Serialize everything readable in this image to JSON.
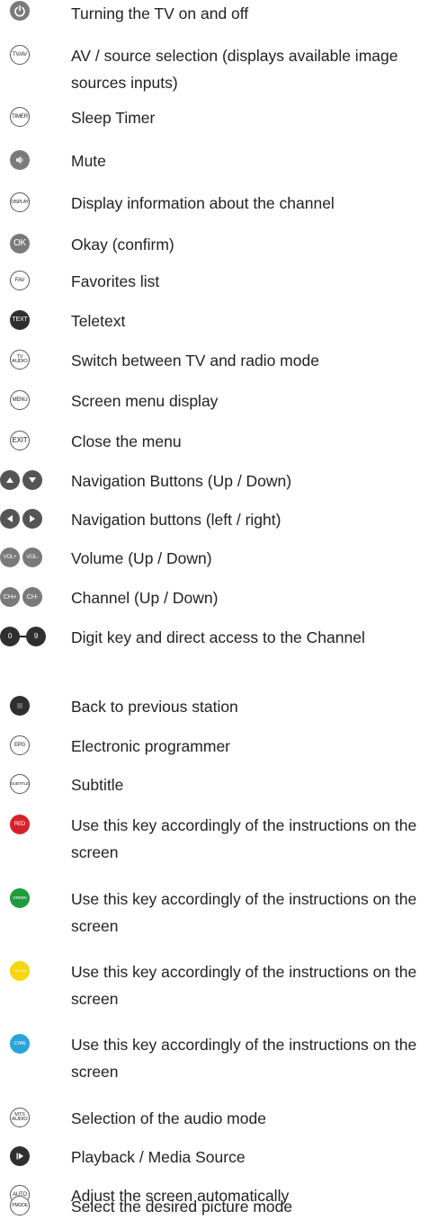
{
  "items": [
    {
      "text": "Turning the TV on and off",
      "icon": "power-icon"
    },
    {
      "text": "AV / source selection (displays available image sources inputs)",
      "icon": "tv-av-icon",
      "label": "TV/AV"
    },
    {
      "text": "Sleep Timer",
      "icon": "timer-icon",
      "label": "TIMER"
    },
    {
      "text": "Mute",
      "icon": "mute-icon"
    },
    {
      "text": "Display information about the channel",
      "icon": "display-icon",
      "label": "DISPLAY"
    },
    {
      "text": "Okay (confirm)",
      "icon": "ok-icon",
      "label": "OK"
    },
    {
      "text": "Favorites list",
      "icon": "fav-icon",
      "label": "FAV"
    },
    {
      "text": "Teletext",
      "icon": "text-icon",
      "label": "TEXT"
    },
    {
      "text": "Switch between TV and radio mode",
      "icon": "tv-audio-icon",
      "label_top": "TV",
      "label_bottom": "AUDIO"
    },
    {
      "text": "Screen menu display",
      "icon": "menu-icon",
      "label": "MENU"
    },
    {
      "text": "Close the menu",
      "icon": "exit-icon",
      "label": "EXIT"
    },
    {
      "text": "Navigation Buttons (Up / Down)",
      "icon": "up-down-icon"
    },
    {
      "text": "Navigation buttons (left / right)",
      "icon": "left-right-icon"
    },
    {
      "text": "Volume (Up / Down)",
      "icon": "vol-icon",
      "labels": [
        "VOL+",
        "VOL-"
      ]
    },
    {
      "text": "Channel (Up / Down)",
      "icon": "ch-icon",
      "labels": [
        "CH+",
        "CH-"
      ]
    },
    {
      "text": "Digit key and direct access to the Channel",
      "icon": "digit-icon",
      "labels": [
        "0",
        "9"
      ]
    },
    {
      "text": "Back to previous station",
      "icon": "back-icon"
    },
    {
      "text": "Electronic programmer",
      "icon": "epg-icon",
      "label": "EPG"
    },
    {
      "text": "Subtitle",
      "icon": "subtitle-icon",
      "label": "SUBTITLE"
    },
    {
      "text": "Use this key accordingly of the instructions on the screen",
      "icon": "red-icon",
      "label": "RED",
      "color": "#d8202a"
    },
    {
      "text": "Use this key accordingly of the instructions on the screen",
      "icon": "green-icon",
      "label": "GREEN",
      "color": "#1f9a3c"
    },
    {
      "text": "Use this key accordingly of the instructions on the screen",
      "icon": "yellow-icon",
      "label": "YELLOW",
      "color": "#f4d60c"
    },
    {
      "text": "Use this key accordingly of the instructions on the screen",
      "icon": "cyan-icon",
      "label": "CYAN",
      "color": "#2aa3dc"
    },
    {
      "text": "Selection of the audio mode",
      "icon": "mts-audio-icon",
      "label_top": "MTS",
      "label_bottom": "AUDIO"
    },
    {
      "text": "Playback / Media Source",
      "icon": "play-icon"
    },
    {
      "text": "Adjust the screen automatically",
      "icon": "auto-icon",
      "label": "AUTO"
    },
    {
      "text": "Select the desired picture mode",
      "icon": "pmode-icon",
      "label": "PMODE"
    }
  ]
}
